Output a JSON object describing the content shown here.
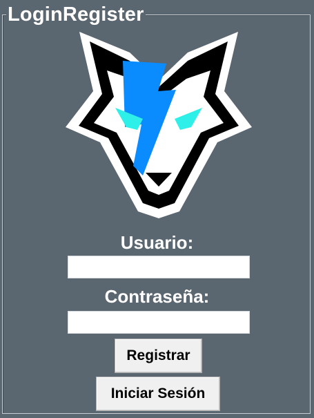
{
  "window": {
    "group_title": "LoginRegister"
  },
  "form": {
    "user_label": "Usuario:",
    "user_value": "",
    "password_label": "Contraseña:",
    "password_value": ""
  },
  "buttons": {
    "register_label": "Registrar",
    "login_label": "Iniciar Sesión"
  },
  "logo": {
    "icon": "wolf-logo-icon",
    "colors": {
      "outline": "#000000",
      "halo": "#ffffff",
      "face": "#ffffff",
      "bolt": "#0a8cff",
      "eyes": "#2ff0e8"
    }
  },
  "theme": {
    "background": "#5b6770",
    "text": "#ffffff",
    "button_bg": "#f0f0f0"
  }
}
